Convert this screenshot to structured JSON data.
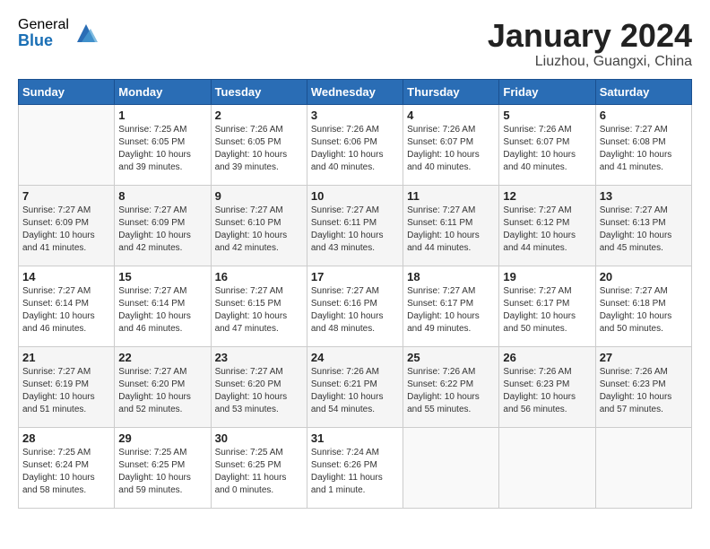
{
  "header": {
    "logo_general": "General",
    "logo_blue": "Blue",
    "month_title": "January 2024",
    "location": "Liuzhou, Guangxi, China"
  },
  "days_of_week": [
    "Sunday",
    "Monday",
    "Tuesday",
    "Wednesday",
    "Thursday",
    "Friday",
    "Saturday"
  ],
  "weeks": [
    [
      {
        "day": "",
        "sunrise": "",
        "sunset": "",
        "daylight": ""
      },
      {
        "day": "1",
        "sunrise": "Sunrise: 7:25 AM",
        "sunset": "Sunset: 6:05 PM",
        "daylight": "Daylight: 10 hours and 39 minutes."
      },
      {
        "day": "2",
        "sunrise": "Sunrise: 7:26 AM",
        "sunset": "Sunset: 6:05 PM",
        "daylight": "Daylight: 10 hours and 39 minutes."
      },
      {
        "day": "3",
        "sunrise": "Sunrise: 7:26 AM",
        "sunset": "Sunset: 6:06 PM",
        "daylight": "Daylight: 10 hours and 40 minutes."
      },
      {
        "day": "4",
        "sunrise": "Sunrise: 7:26 AM",
        "sunset": "Sunset: 6:07 PM",
        "daylight": "Daylight: 10 hours and 40 minutes."
      },
      {
        "day": "5",
        "sunrise": "Sunrise: 7:26 AM",
        "sunset": "Sunset: 6:07 PM",
        "daylight": "Daylight: 10 hours and 40 minutes."
      },
      {
        "day": "6",
        "sunrise": "Sunrise: 7:27 AM",
        "sunset": "Sunset: 6:08 PM",
        "daylight": "Daylight: 10 hours and 41 minutes."
      }
    ],
    [
      {
        "day": "7",
        "sunrise": "Sunrise: 7:27 AM",
        "sunset": "Sunset: 6:09 PM",
        "daylight": "Daylight: 10 hours and 41 minutes."
      },
      {
        "day": "8",
        "sunrise": "Sunrise: 7:27 AM",
        "sunset": "Sunset: 6:09 PM",
        "daylight": "Daylight: 10 hours and 42 minutes."
      },
      {
        "day": "9",
        "sunrise": "Sunrise: 7:27 AM",
        "sunset": "Sunset: 6:10 PM",
        "daylight": "Daylight: 10 hours and 42 minutes."
      },
      {
        "day": "10",
        "sunrise": "Sunrise: 7:27 AM",
        "sunset": "Sunset: 6:11 PM",
        "daylight": "Daylight: 10 hours and 43 minutes."
      },
      {
        "day": "11",
        "sunrise": "Sunrise: 7:27 AM",
        "sunset": "Sunset: 6:11 PM",
        "daylight": "Daylight: 10 hours and 44 minutes."
      },
      {
        "day": "12",
        "sunrise": "Sunrise: 7:27 AM",
        "sunset": "Sunset: 6:12 PM",
        "daylight": "Daylight: 10 hours and 44 minutes."
      },
      {
        "day": "13",
        "sunrise": "Sunrise: 7:27 AM",
        "sunset": "Sunset: 6:13 PM",
        "daylight": "Daylight: 10 hours and 45 minutes."
      }
    ],
    [
      {
        "day": "14",
        "sunrise": "Sunrise: 7:27 AM",
        "sunset": "Sunset: 6:14 PM",
        "daylight": "Daylight: 10 hours and 46 minutes."
      },
      {
        "day": "15",
        "sunrise": "Sunrise: 7:27 AM",
        "sunset": "Sunset: 6:14 PM",
        "daylight": "Daylight: 10 hours and 46 minutes."
      },
      {
        "day": "16",
        "sunrise": "Sunrise: 7:27 AM",
        "sunset": "Sunset: 6:15 PM",
        "daylight": "Daylight: 10 hours and 47 minutes."
      },
      {
        "day": "17",
        "sunrise": "Sunrise: 7:27 AM",
        "sunset": "Sunset: 6:16 PM",
        "daylight": "Daylight: 10 hours and 48 minutes."
      },
      {
        "day": "18",
        "sunrise": "Sunrise: 7:27 AM",
        "sunset": "Sunset: 6:17 PM",
        "daylight": "Daylight: 10 hours and 49 minutes."
      },
      {
        "day": "19",
        "sunrise": "Sunrise: 7:27 AM",
        "sunset": "Sunset: 6:17 PM",
        "daylight": "Daylight: 10 hours and 50 minutes."
      },
      {
        "day": "20",
        "sunrise": "Sunrise: 7:27 AM",
        "sunset": "Sunset: 6:18 PM",
        "daylight": "Daylight: 10 hours and 50 minutes."
      }
    ],
    [
      {
        "day": "21",
        "sunrise": "Sunrise: 7:27 AM",
        "sunset": "Sunset: 6:19 PM",
        "daylight": "Daylight: 10 hours and 51 minutes."
      },
      {
        "day": "22",
        "sunrise": "Sunrise: 7:27 AM",
        "sunset": "Sunset: 6:20 PM",
        "daylight": "Daylight: 10 hours and 52 minutes."
      },
      {
        "day": "23",
        "sunrise": "Sunrise: 7:27 AM",
        "sunset": "Sunset: 6:20 PM",
        "daylight": "Daylight: 10 hours and 53 minutes."
      },
      {
        "day": "24",
        "sunrise": "Sunrise: 7:26 AM",
        "sunset": "Sunset: 6:21 PM",
        "daylight": "Daylight: 10 hours and 54 minutes."
      },
      {
        "day": "25",
        "sunrise": "Sunrise: 7:26 AM",
        "sunset": "Sunset: 6:22 PM",
        "daylight": "Daylight: 10 hours and 55 minutes."
      },
      {
        "day": "26",
        "sunrise": "Sunrise: 7:26 AM",
        "sunset": "Sunset: 6:23 PM",
        "daylight": "Daylight: 10 hours and 56 minutes."
      },
      {
        "day": "27",
        "sunrise": "Sunrise: 7:26 AM",
        "sunset": "Sunset: 6:23 PM",
        "daylight": "Daylight: 10 hours and 57 minutes."
      }
    ],
    [
      {
        "day": "28",
        "sunrise": "Sunrise: 7:25 AM",
        "sunset": "Sunset: 6:24 PM",
        "daylight": "Daylight: 10 hours and 58 minutes."
      },
      {
        "day": "29",
        "sunrise": "Sunrise: 7:25 AM",
        "sunset": "Sunset: 6:25 PM",
        "daylight": "Daylight: 10 hours and 59 minutes."
      },
      {
        "day": "30",
        "sunrise": "Sunrise: 7:25 AM",
        "sunset": "Sunset: 6:25 PM",
        "daylight": "Daylight: 11 hours and 0 minutes."
      },
      {
        "day": "31",
        "sunrise": "Sunrise: 7:24 AM",
        "sunset": "Sunset: 6:26 PM",
        "daylight": "Daylight: 11 hours and 1 minute."
      },
      {
        "day": "",
        "sunrise": "",
        "sunset": "",
        "daylight": ""
      },
      {
        "day": "",
        "sunrise": "",
        "sunset": "",
        "daylight": ""
      },
      {
        "day": "",
        "sunrise": "",
        "sunset": "",
        "daylight": ""
      }
    ]
  ]
}
